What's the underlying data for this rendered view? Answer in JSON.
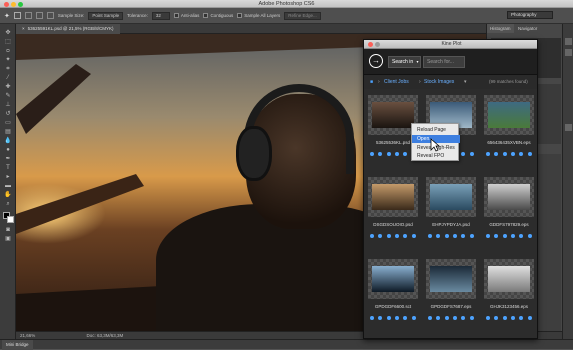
{
  "app": {
    "title": "Adobe Photoshop CS6"
  },
  "options_bar": {
    "sample_size_label": "Sample Size:",
    "sample_size_value": "Point Sample",
    "tolerance_label": "Tolerance:",
    "tolerance_value": "32",
    "anti_alias_label": "Anti-alias",
    "contiguous_label": "Contiguous",
    "sample_all_layers_label": "Sample All Layers",
    "refine_edge_label": "Refine Edge...",
    "workspace_value": "Photography"
  },
  "document": {
    "tab_label": "53625591KL.psd @ 21,5% (RGB/8/CMYK)",
    "zoom": "21,66%",
    "doc_info": "Doc: 63,3M/63,3M"
  },
  "right_panel": {
    "tabs": [
      "Histogram",
      "Navigator"
    ]
  },
  "bottom_tab": "Mini Bridge",
  "keen_plot": {
    "title": "Kine Plot",
    "search_scope": "Search in",
    "search_placeholder": "Search for...",
    "breadcrumb": [
      "Client Jobs",
      "Stock Images"
    ],
    "match_count": "(99 matches found)",
    "items": [
      {
        "filename": "53625536KL.psd"
      },
      {
        "filename": ""
      },
      {
        "filename": "656436435XVBN.eps"
      },
      {
        "filename": "DSGDSOUOIO.psd"
      },
      {
        "filename": "EHPJYPDYJA.psd"
      },
      {
        "filename": "GDDFS797829.eps"
      },
      {
        "filename": "GPDGDF6600.sct"
      },
      {
        "filename": "GPDGDFS7687.eps"
      },
      {
        "filename": "GHJK3123456.eps"
      }
    ]
  },
  "context_menu": {
    "items": [
      "Reload Page",
      "Open...",
      "Reveal High-Res",
      "Reveal FPO"
    ]
  }
}
